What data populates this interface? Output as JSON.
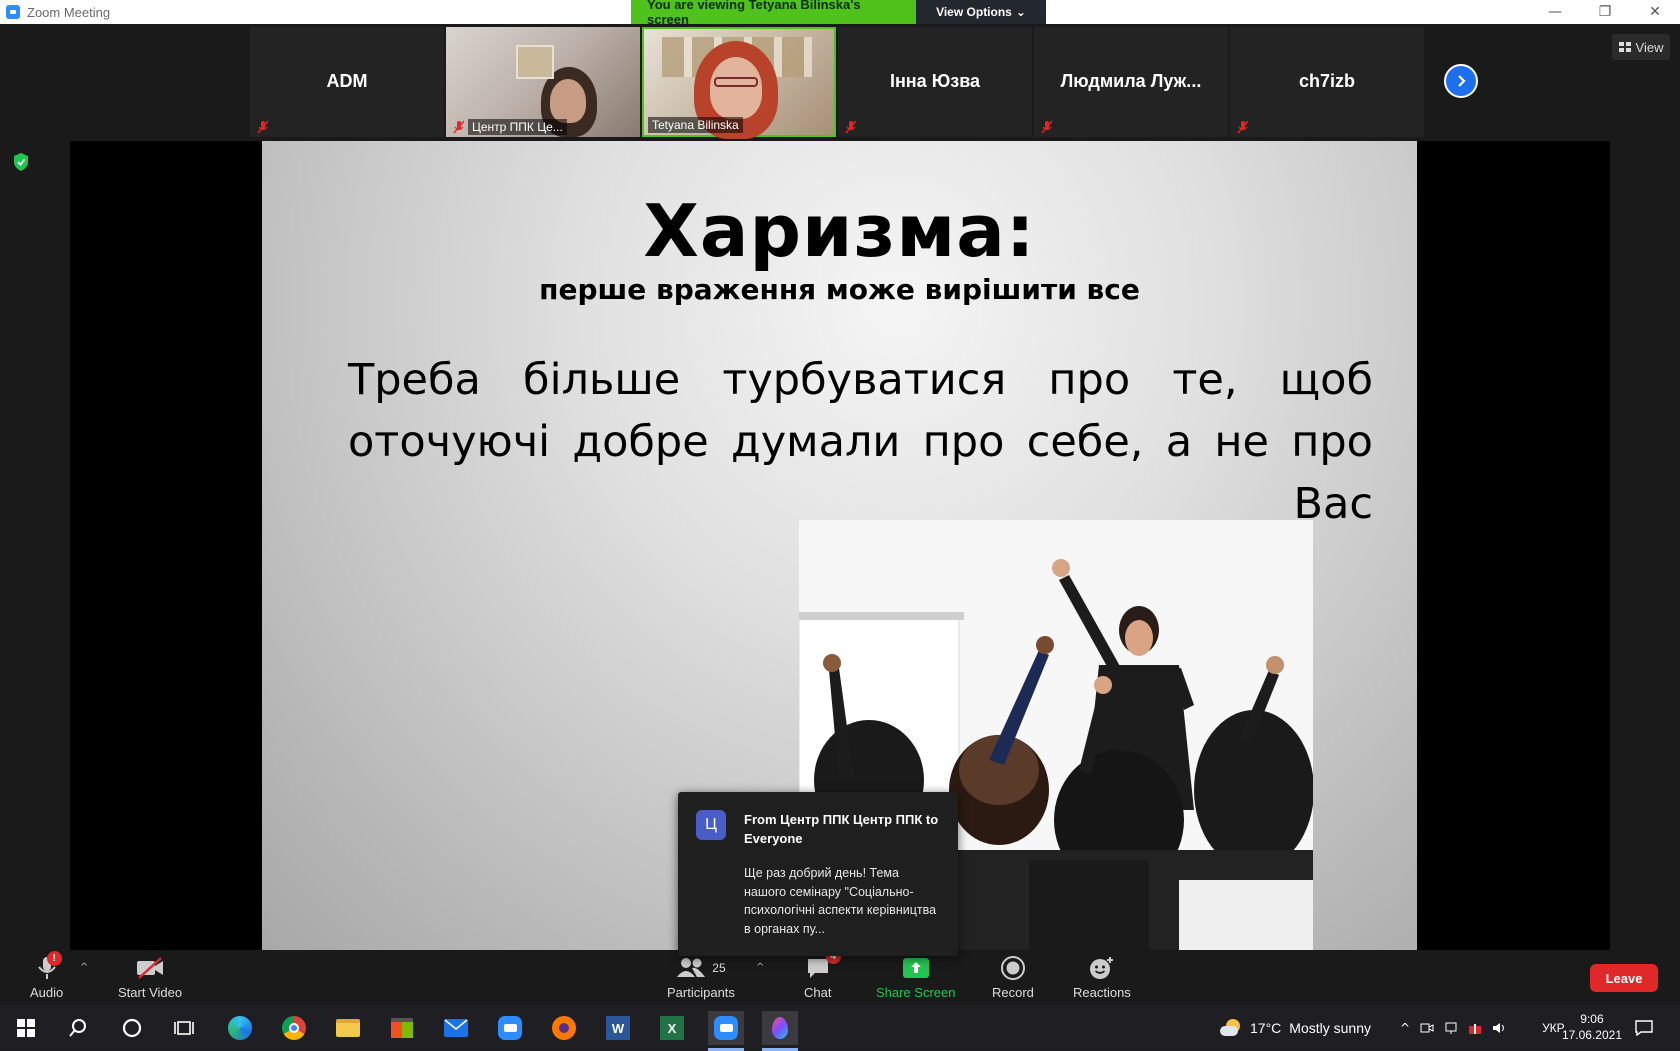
{
  "window": {
    "title": "Zoom Meeting"
  },
  "banner": {
    "viewing_text": "You are viewing Tetyana Bilinska's screen",
    "view_options_label": "View Options"
  },
  "top_right": {
    "view_label": "View"
  },
  "participants_strip": [
    {
      "name": "ADM",
      "muted": true,
      "video": false
    },
    {
      "name": "Центр ППК Це...",
      "muted": true,
      "video": true
    },
    {
      "name": "Tetyana Bilinska",
      "muted": false,
      "video": true,
      "speaking": true
    },
    {
      "name": "Інна Юзва",
      "muted": true,
      "video": false
    },
    {
      "name": "Людмила  Луж...",
      "muted": true,
      "video": false
    },
    {
      "name": "ch7izb",
      "muted": true,
      "video": false
    }
  ],
  "slide": {
    "title": "Харизма:",
    "subtitle": "перше враження може вирішити все",
    "body": "Треба більше турбуватися про те, щоб оточуючі добре думали про себе, а не про Вас"
  },
  "chat_popup": {
    "avatar_letter": "Ц",
    "from": "From Центр ППК Центр ППК to Everyone",
    "message": "Ще раз добрий день! Тема нашого семінару \"Соціально-психологічні аспекти керівництва в органах пу..."
  },
  "toolbar": {
    "audio_label": "Audio",
    "audio_alert": "!",
    "start_video_label": "Start Video",
    "participants_label": "Participants",
    "participants_count": "25",
    "chat_label": "Chat",
    "chat_badge": "4",
    "share_screen_label": "Share Screen",
    "record_label": "Record",
    "reactions_label": "Reactions",
    "leave_label": "Leave"
  },
  "taskbar": {
    "weather_temp": "17°C",
    "weather_text": "Mostly sunny",
    "language": "УКР",
    "time": "9:06",
    "date": "17.06.2021"
  },
  "colors": {
    "accent_green": "#4fc21b",
    "leave_red": "#e02828",
    "zoom_blue": "#2d8cff",
    "share_green": "#23c552"
  }
}
